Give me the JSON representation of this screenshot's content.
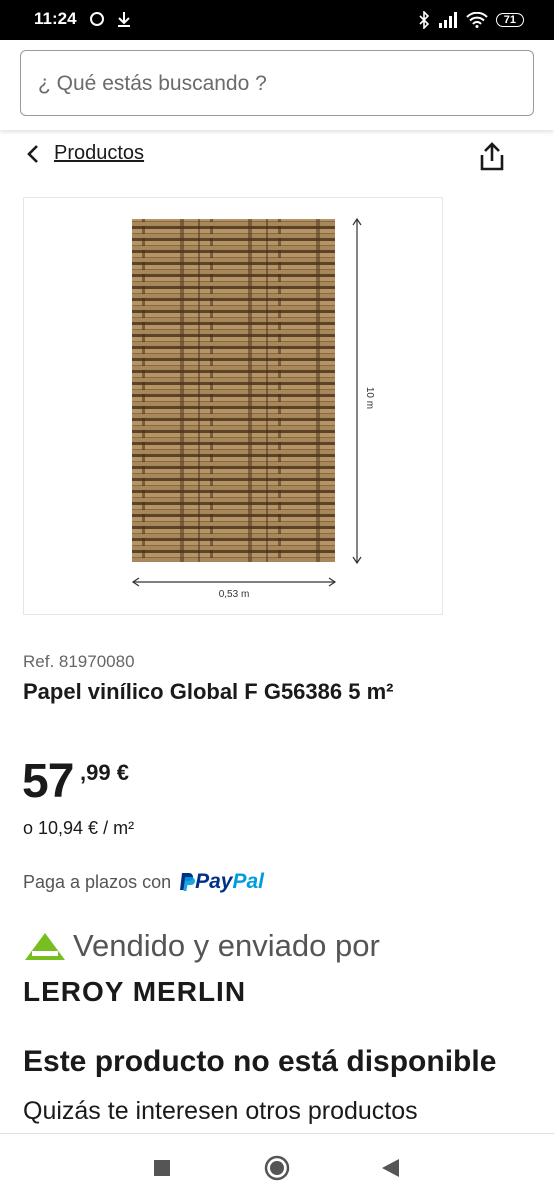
{
  "status_bar": {
    "time": "11:24",
    "battery": "71"
  },
  "search": {
    "placeholder": "¿ Qué estás buscando ?"
  },
  "breadcrumb": {
    "label": "Productos"
  },
  "product_image": {
    "height_label": "10 m",
    "width_label": "0,53 m"
  },
  "product": {
    "ref": "Ref. 81970080",
    "title": "Papel vinílico Global F G56386 5 m²",
    "price_integer": "57",
    "price_decimal": ",99 €",
    "unit_price": "o 10,94 € / m²"
  },
  "payment": {
    "text": "Paga a plazos con",
    "logo_pay": "Pay",
    "logo_pal": "Pal"
  },
  "seller": {
    "sold_by": "Vendido y enviado por",
    "brand": "LEROY MERLIN",
    "logo_text": "LEROY MERLIN"
  },
  "availability": {
    "title": "Este producto no está disponible",
    "subtitle": "Quizás te interesen otros productos"
  },
  "colors": {
    "brand_green": "#78be20",
    "paypal_dark": "#003087",
    "paypal_light": "#009cde"
  }
}
